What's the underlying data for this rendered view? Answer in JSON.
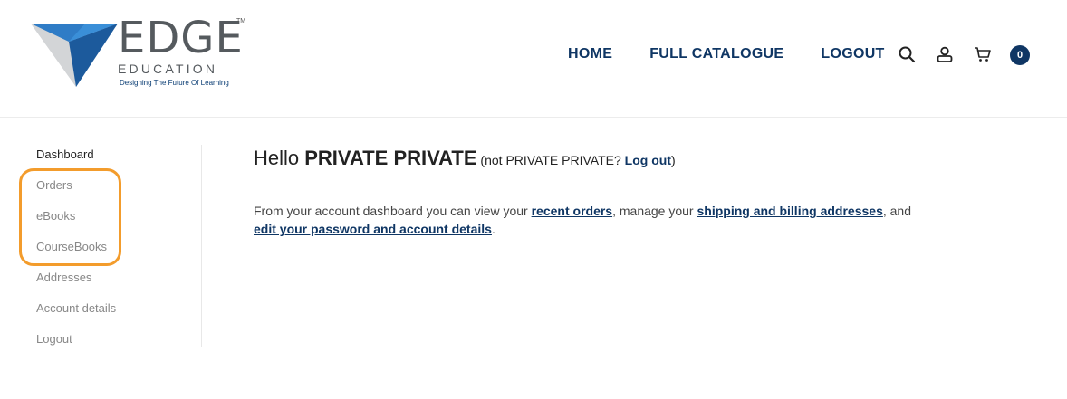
{
  "brand": {
    "name": "EDGE",
    "tm": "TM",
    "sub": "EDUCATION",
    "tagline": "Designing The Future Of Learning"
  },
  "nav": {
    "items": [
      "HOME",
      "FULL CATALOGUE",
      "LOGOUT"
    ]
  },
  "header_icons": [
    "search-icon",
    "user-icon",
    "cart-icon"
  ],
  "cart": {
    "count": "0"
  },
  "sidebar": {
    "items": [
      "Dashboard",
      "Orders",
      "eBooks",
      "CourseBooks",
      "Addresses",
      "Account details",
      "Logout"
    ]
  },
  "greeting": {
    "hello": "Hello ",
    "name": "PRIVATE PRIVATE",
    "not_open": " (not ",
    "not_name": "PRIVATE PRIVATE",
    "question": "? ",
    "logout_link": "Log out",
    "close": ")"
  },
  "description": {
    "part1": "From your account dashboard you can view your ",
    "link1": "recent orders",
    "part2": ", manage your ",
    "link2": "shipping and billing addresses",
    "part3": ", and",
    "link3": "edit your password and account details",
    "part4": "."
  },
  "colors": {
    "brand_navy": "#0f3664",
    "highlight_orange": "#f39c2c",
    "logo_blue": "#1c5a9c",
    "logo_grey": "#c9cbcd"
  }
}
